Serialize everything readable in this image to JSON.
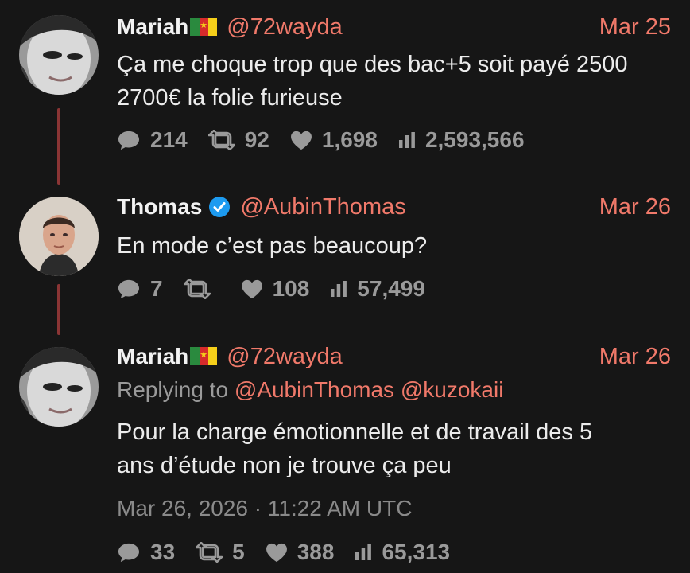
{
  "tweets": [
    {
      "name": "Mariah",
      "flag": "cameroon-flag",
      "verified": false,
      "handle": "@72wayda",
      "date": "Mar 25",
      "text_line1": "Ça me choque trop que des bac+5 soit payé 2500",
      "text_line2": "2700€ la folie furieuse",
      "stats": {
        "replies": "214",
        "retweets": "92",
        "likes": "1,698",
        "views": "2,593,566"
      }
    },
    {
      "name": "Thomas",
      "verified": true,
      "handle": "@AubinThomas",
      "date": "Mar 26",
      "text_line1": "En mode c’est pas beaucoup?",
      "stats": {
        "replies": "7",
        "retweets": "",
        "likes": "108",
        "views": "57,499"
      }
    },
    {
      "name": "Mariah",
      "flag": "cameroon-flag",
      "verified": false,
      "handle": "@72wayda",
      "date": "Mar 26",
      "replying_prefix": "Replying to",
      "replying_mention1": "@AubinThomas",
      "replying_mention2": "@kuzokaii",
      "text_line1": "Pour la charge émotionnelle et de travail des 5",
      "text_line2": "ans d’étude non je trouve ça peu",
      "timestamp": "Mar 26, 2026 · 11:22 AM UTC",
      "stats": {
        "replies": "33",
        "retweets": "5",
        "likes": "388",
        "views": "65,313"
      }
    }
  ],
  "colors": {
    "background": "#161616",
    "accent": "#f0796a",
    "thread_line": "#8b3535",
    "muted": "#9a9a9a",
    "verified": "#1d9bf0"
  }
}
